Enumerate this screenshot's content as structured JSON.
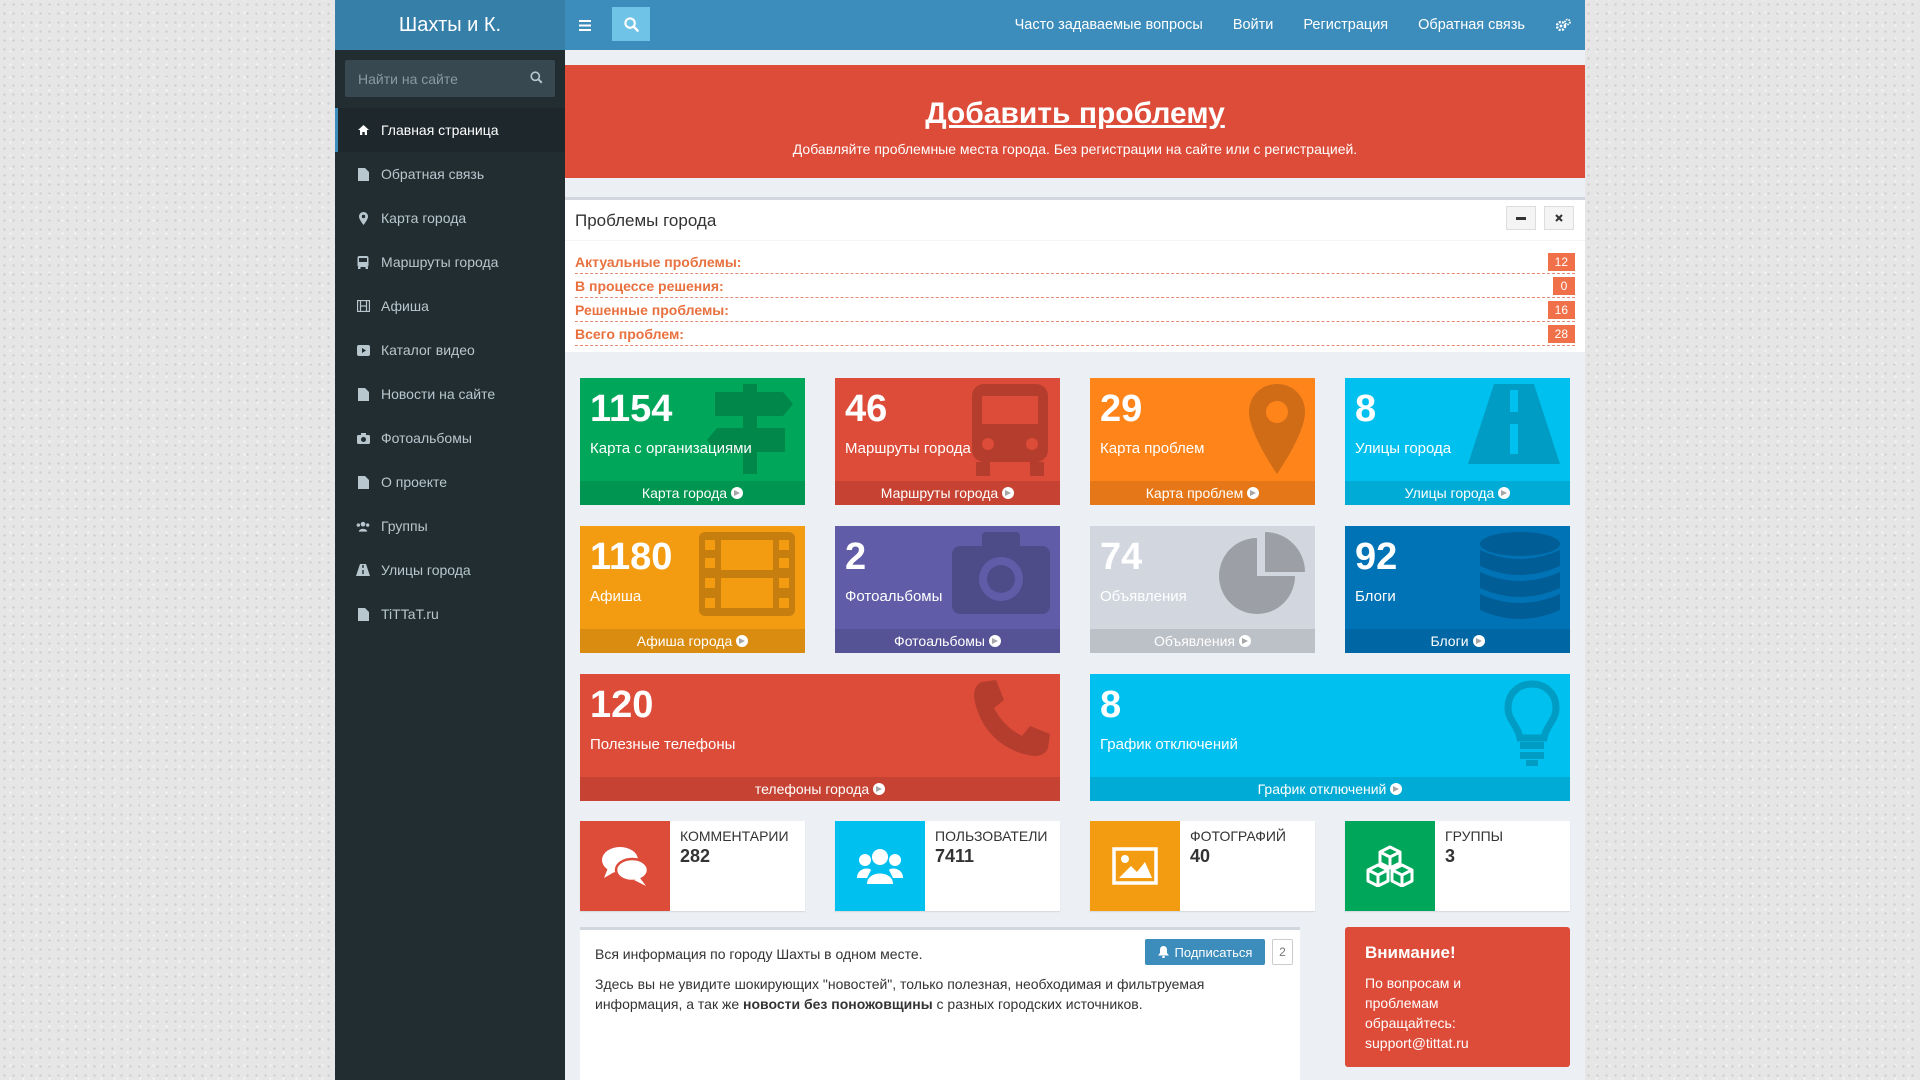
{
  "header": {
    "logo": "Шахты и К.",
    "nav": [
      "Часто задаваемые вопросы",
      "Войти",
      "Регистрация",
      "Обратная связь"
    ]
  },
  "sidebar": {
    "search_placeholder": "Найти на сайте",
    "items": [
      {
        "label": "Главная страница",
        "icon": "home-icon"
      },
      {
        "label": "Обратная связь",
        "icon": "file-icon"
      },
      {
        "label": "Карта города",
        "icon": "map-marker-icon"
      },
      {
        "label": "Маршруты города",
        "icon": "bus-icon"
      },
      {
        "label": "Афиша",
        "icon": "film-icon"
      },
      {
        "label": "Каталог видео",
        "icon": "video-icon"
      },
      {
        "label": "Новости на сайте",
        "icon": "file-icon"
      },
      {
        "label": "Фотоальбомы",
        "icon": "camera-icon"
      },
      {
        "label": "О проекте",
        "icon": "file-icon"
      },
      {
        "label": "Группы",
        "icon": "users-icon"
      },
      {
        "label": "Улицы города",
        "icon": "road-icon"
      },
      {
        "label": "TiTTaT.ru",
        "icon": "file-icon"
      }
    ]
  },
  "banner": {
    "title": "Добавить проблему",
    "subtitle": "Добавляйте проблемные места города. Без регистрации на сайте или с регистрацией."
  },
  "problems": {
    "title": "Проблемы города",
    "rows": [
      {
        "label": "Актуальные проблемы:",
        "count": "12"
      },
      {
        "label": "В процессе решения:",
        "count": "0"
      },
      {
        "label": "Решенные проблемы:",
        "count": "16"
      },
      {
        "label": "Всего проблем:",
        "count": "28"
      }
    ]
  },
  "tiles": [
    {
      "num": "1154",
      "label": "Карта с организациями",
      "footer": "Карта города",
      "color": "#00a65a",
      "icon": "signpost-icon"
    },
    {
      "num": "46",
      "label": "Маршруты города",
      "footer": "Маршруты города",
      "color": "#dd4b39",
      "icon": "bus-icon"
    },
    {
      "num": "29",
      "label": "Карта проблем",
      "footer": "Карта проблем",
      "color": "#ff851b",
      "icon": "map-marker-icon"
    },
    {
      "num": "8",
      "label": "Улицы города",
      "footer": "Улицы города",
      "color": "#00c0ef",
      "icon": "road-icon"
    },
    {
      "num": "1180",
      "label": "Афиша",
      "footer": "Афиша города",
      "color": "#f39c12",
      "icon": "film-icon"
    },
    {
      "num": "2",
      "label": "Фотоальбомы",
      "footer": "Фотоальбомы",
      "color": "#605ca8",
      "icon": "camera-icon"
    },
    {
      "num": "74",
      "label": "Объявления",
      "footer": "Объявления",
      "color": "#d2d6de",
      "icon": "pie-chart-icon"
    },
    {
      "num": "92",
      "label": "Блоги",
      "footer": "Блоги",
      "color": "#0073b7",
      "icon": "database-icon"
    },
    {
      "num": "120",
      "label": "Полезные телефоны",
      "footer": "телефоны города",
      "color": "#dd4b39",
      "icon": "phone-icon"
    },
    {
      "num": "8",
      "label": "График отключений",
      "footer": "График отключений",
      "color": "#00c0ef",
      "icon": "lightbulb-icon"
    }
  ],
  "infoboxes": [
    {
      "label": "КОММЕНТАРИИ",
      "value": "282",
      "color": "#dd4b39",
      "icon": "comments-icon"
    },
    {
      "label": "ПОЛЬЗОВАТЕЛИ",
      "value": "7411",
      "color": "#00c0ef",
      "icon": "users-icon"
    },
    {
      "label": "ФОТОГРАФИЙ",
      "value": "40",
      "color": "#f39c12",
      "icon": "image-icon"
    },
    {
      "label": "ГРУППЫ",
      "value": "3",
      "color": "#00a65a",
      "icon": "cubes-icon"
    }
  ],
  "about": {
    "line1": "Вся информация по городу Шахты в одном месте.",
    "line2a": "Здесь вы не увидите шокирующих \"новостей\", только полезная, необходимая и фильтруемая информация, а так же ",
    "line2b": "новости без поножовщины",
    "line2c": " с разных городских источников.",
    "subscribe": "Подписаться",
    "subscribe_count": "2"
  },
  "notice": {
    "title": "Внимание!",
    "text": "По вопросам и проблемам обращайтесь: support@tittat.ru"
  }
}
